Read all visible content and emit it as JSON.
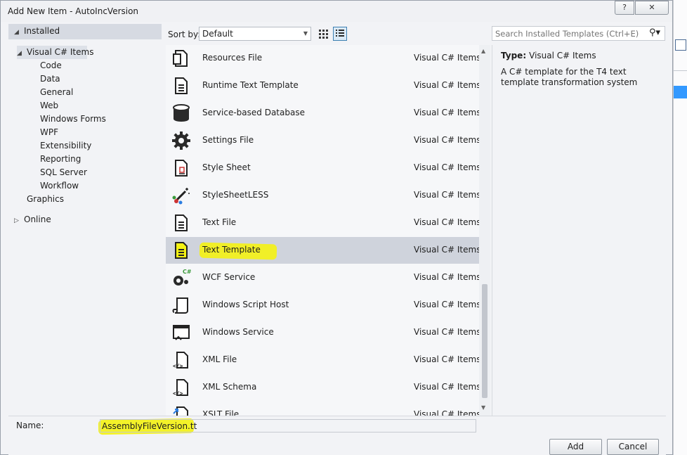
{
  "window": {
    "title": "Add New Item - AutoIncVersion",
    "help_label": "?",
    "close_label": "✕"
  },
  "tree": {
    "installed": "Installed",
    "visual_cs_items": "Visual C# Items",
    "children": [
      "Code",
      "Data",
      "General",
      "Web",
      "Windows Forms",
      "WPF",
      "Extensibility",
      "Reporting",
      "SQL Server",
      "Workflow"
    ],
    "graphics": "Graphics",
    "online": "Online"
  },
  "toolbar": {
    "sort_label": "Sort by:",
    "sort_value": "Default",
    "search_placeholder": "Search Installed Templates (Ctrl+E)"
  },
  "templates": [
    {
      "name": "Resources File",
      "category": "Visual C# Items",
      "icon": "resource-file-icon"
    },
    {
      "name": "Runtime Text Template",
      "category": "Visual C# Items",
      "icon": "text-doc-icon"
    },
    {
      "name": "Service-based Database",
      "category": "Visual C# Items",
      "icon": "database-icon"
    },
    {
      "name": "Settings File",
      "category": "Visual C# Items",
      "icon": "gear-icon"
    },
    {
      "name": "Style Sheet",
      "category": "Visual C# Items",
      "icon": "stylesheet-icon"
    },
    {
      "name": "StyleSheetLESS",
      "category": "Visual C# Items",
      "icon": "magic-wand-icon"
    },
    {
      "name": "Text File",
      "category": "Visual C# Items",
      "icon": "text-file-icon"
    },
    {
      "name": "Text Template",
      "category": "Visual C# Items",
      "icon": "text-template-icon"
    },
    {
      "name": "WCF Service",
      "category": "Visual C# Items",
      "icon": "wcf-service-icon"
    },
    {
      "name": "Windows Script Host",
      "category": "Visual C# Items",
      "icon": "scroll-icon"
    },
    {
      "name": "Windows Service",
      "category": "Visual C# Items",
      "icon": "windows-service-icon"
    },
    {
      "name": "XML File",
      "category": "Visual C# Items",
      "icon": "xml-file-icon"
    },
    {
      "name": "XML Schema",
      "category": "Visual C# Items",
      "icon": "xml-schema-icon"
    },
    {
      "name": "XSLT File",
      "category": "Visual C# Items",
      "icon": "xslt-file-icon"
    }
  ],
  "selected_template": "Text Template",
  "details": {
    "type_label": "Type:",
    "type_value": "Visual C# Items",
    "description": "A C# template for the T4 text template transformation system"
  },
  "name_field": {
    "label": "Name:",
    "value": "AssemblyFileVersion.tt"
  },
  "buttons": {
    "add": "Add",
    "cancel": "Cancel"
  },
  "colors": {
    "highlight": "#f4f213",
    "selection": "#cfd3dc",
    "accent": "#3399ff"
  }
}
